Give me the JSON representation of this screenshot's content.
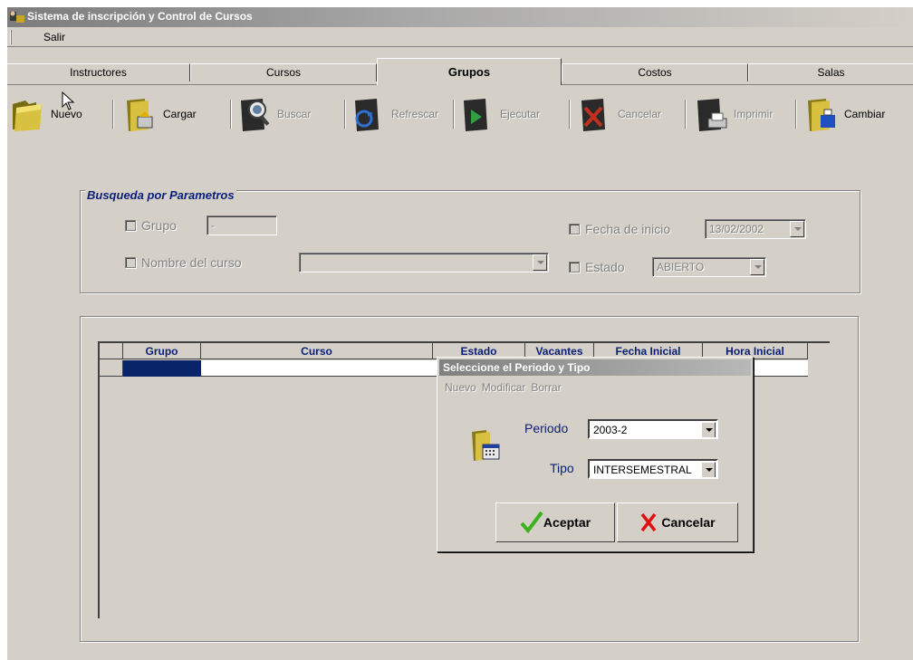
{
  "window": {
    "title": "Sistema de inscripción y Control de Cursos"
  },
  "menubar": {
    "items": [
      "Salir"
    ]
  },
  "tabs": [
    {
      "label": "Instructores",
      "active": false
    },
    {
      "label": "Cursos",
      "active": false
    },
    {
      "label": "Grupos",
      "active": true
    },
    {
      "label": "Costos",
      "active": false
    },
    {
      "label": "Salas",
      "active": false
    }
  ],
  "toolbar": {
    "buttons": [
      {
        "label": "Nuevo",
        "icon": "folder-open-icon",
        "enabled": true
      },
      {
        "label": "Cargar",
        "icon": "folder-upload-icon",
        "enabled": true
      },
      {
        "label": "Buscar",
        "icon": "book-search-icon",
        "enabled": false
      },
      {
        "label": "Refrescar",
        "icon": "book-refresh-icon",
        "enabled": false
      },
      {
        "label": "Ejecutar",
        "icon": "book-run-icon",
        "enabled": false
      },
      {
        "label": "Cancelar",
        "icon": "book-cancel-icon",
        "enabled": false
      },
      {
        "label": "Imprimir",
        "icon": "book-print-icon",
        "enabled": false
      },
      {
        "label": "Cambiar",
        "icon": "folder-change-icon",
        "enabled": true
      }
    ]
  },
  "search": {
    "legend": "Busqueda por Parametros",
    "grupo_label": "Grupo",
    "grupo_value": "-",
    "nombre_curso_label": "Nombre del curso",
    "nombre_curso_value": "",
    "fecha_inicio_label": "Fecha de inicio",
    "fecha_inicio_value": "13/02/2002",
    "estado_label": "Estado",
    "estado_value": "ABIERTO"
  },
  "grid": {
    "columns": [
      "Grupo",
      "Curso",
      "Estado",
      "Vacantes",
      "Fecha Inicial",
      "Hora Inicial"
    ]
  },
  "dialog": {
    "title": "Seleccione el Periodo y Tipo",
    "menu": [
      "Nuevo",
      "Modificar",
      "Borrar"
    ],
    "periodo_label": "Periodo",
    "periodo_value": "2003-2",
    "tipo_label": "Tipo",
    "tipo_value": "INTERSEMESTRAL",
    "accept_label": "Aceptar",
    "cancel_label": "Cancelar"
  },
  "colors": {
    "window_bg": "#d4d0c8",
    "label_blue": "#0a1e78",
    "selection": "#0a246a",
    "accept_check": "#3cb020",
    "cancel_x": "#e01010"
  }
}
